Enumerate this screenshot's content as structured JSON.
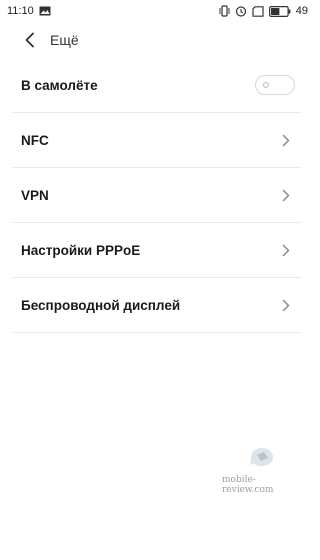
{
  "status_bar": {
    "time": "11:10",
    "battery": "49",
    "icons": [
      "image-notification-icon",
      "vibrate-icon",
      "alarm-icon",
      "sim-card-icon",
      "battery-icon"
    ]
  },
  "app_bar": {
    "title": "Ещё",
    "back_icon": "back-arrow-icon"
  },
  "settings": [
    {
      "label": "В самолёте",
      "control": "toggle",
      "on": false
    },
    {
      "label": "NFC",
      "control": "chevron"
    },
    {
      "label": "VPN",
      "control": "chevron"
    },
    {
      "label": "Настройки PPPoE",
      "control": "chevron"
    },
    {
      "label": "Беспроводной дисплей",
      "control": "chevron"
    }
  ],
  "watermark": {
    "text": "mobile-review.com"
  },
  "colors": {
    "divider": "#e8e8e8",
    "text": "#1a1a1a",
    "chevron": "#8a8a8a",
    "watermark": "#9aa0a6"
  }
}
